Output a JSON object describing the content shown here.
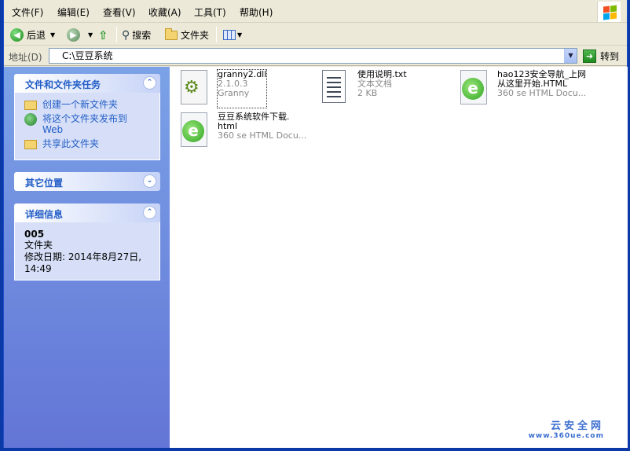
{
  "menu": [
    "文件(F)",
    "编辑(E)",
    "查看(V)",
    "收藏(A)",
    "工具(T)",
    "帮助(H)"
  ],
  "toolbar": {
    "back_label": "后退",
    "search_label": "搜索",
    "folders_label": "文件夹"
  },
  "address": {
    "label": "地址(D)",
    "value": "C:\\豆豆系统",
    "go_label": "转到"
  },
  "taskpane": {
    "tasks_title": "文件和文件夹任务",
    "tasks": [
      {
        "label": "创建一个新文件夹",
        "icon": "new-folder-icon"
      },
      {
        "label": "将这个文件夹发布到\nWeb",
        "icon": "publish-web-icon"
      },
      {
        "label": "共享此文件夹",
        "icon": "share-folder-icon"
      }
    ],
    "other_title": "其它位置",
    "details_title": "详细信息",
    "details": {
      "name": "005",
      "type": "文件夹",
      "modified": "修改日期: 2014年8月27日,\n14:49"
    }
  },
  "files": [
    {
      "name": "granny2.dll",
      "sub1": "2.1.0.3",
      "sub2": "Granny",
      "icon": "dll-gear-icon"
    },
    {
      "name": "使用说明.txt",
      "sub1": "文本文档",
      "sub2": "2 KB",
      "icon": "text-document-icon"
    },
    {
      "name": "hao123安全导航_上网\n从这里开始.HTML",
      "sub1": "360 se HTML Docu...",
      "sub2": "",
      "icon": "360se-html-icon"
    },
    {
      "name": "豆豆系统软件下载.\nhtml",
      "sub1": "360 se HTML Docu...",
      "sub2": "",
      "icon": "360se-html-icon"
    }
  ],
  "watermark": {
    "line1": "云安全网",
    "line2": "www.360ue.com"
  },
  "colors": {
    "link_blue": "#215dc6",
    "taskpane_top": "#7ba2e7",
    "taskpane_bottom": "#6375d6"
  }
}
